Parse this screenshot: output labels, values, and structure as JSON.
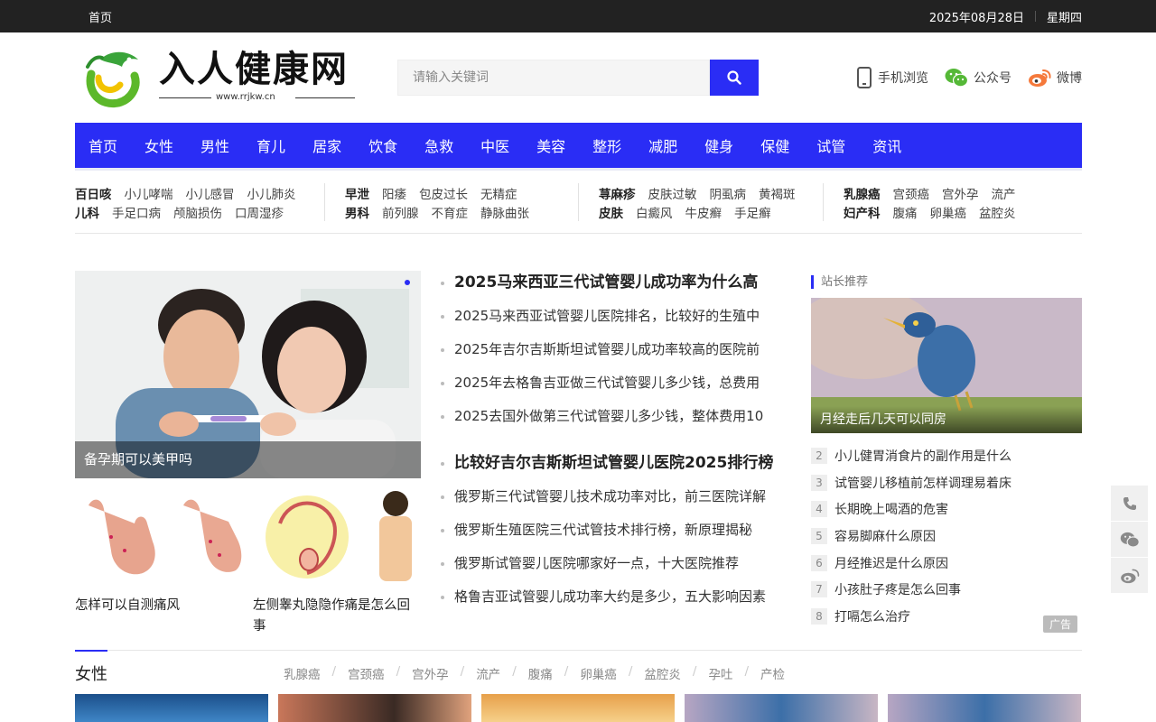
{
  "topbar": {
    "home": "首页",
    "date": "2025年08月28日",
    "weekday": "星期四"
  },
  "logo": {
    "name": "入人健康网",
    "url": "www.rrjkw.cn"
  },
  "search": {
    "placeholder": "请输入关键词"
  },
  "header_links": {
    "mobile": "手机浏览",
    "wechat": "公众号",
    "weibo": "微博"
  },
  "nav": [
    "首页",
    "女性",
    "男性",
    "育儿",
    "居家",
    "饮食",
    "急救",
    "中医",
    "美容",
    "整形",
    "减肥",
    "健身",
    "保健",
    "试管",
    "资讯"
  ],
  "tag_groups": [
    {
      "rows": [
        {
          "head": "百日咳",
          "items": [
            "小儿哮喘",
            "小儿感冒",
            "小儿肺炎"
          ]
        },
        {
          "head": "儿科",
          "items": [
            "手足口病",
            "颅脑损伤",
            "口周湿疹"
          ]
        }
      ]
    },
    {
      "rows": [
        {
          "head": "早泄",
          "items": [
            "阳痿",
            "包皮过长",
            "无精症"
          ]
        },
        {
          "head": "男科",
          "items": [
            "前列腺",
            "不育症",
            "静脉曲张"
          ]
        }
      ]
    },
    {
      "rows": [
        {
          "head": "荨麻疹",
          "items": [
            "皮肤过敏",
            "阴虱病",
            "黄褐斑"
          ]
        },
        {
          "head": "皮肤",
          "items": [
            "白癜风",
            "牛皮癣",
            "手足癣"
          ]
        }
      ]
    },
    {
      "rows": [
        {
          "head": "乳腺癌",
          "items": [
            "宫颈癌",
            "宫外孕",
            "流产"
          ]
        },
        {
          "head": "妇产科",
          "items": [
            "腹痛",
            "卵巢癌",
            "盆腔炎"
          ]
        }
      ]
    }
  ],
  "hero": {
    "caption": "备孕期可以美甲吗"
  },
  "thumbs": [
    {
      "caption": "怎样可以自测痛风"
    },
    {
      "caption": "左侧睾丸隐隐作痛是怎么回事"
    }
  ],
  "news_group1": [
    "2025马来西亚三代试管婴儿成功率为什么高",
    "2025马来西亚试管婴儿医院排名，比较好的生殖中",
    "2025年吉尔吉斯斯坦试管婴儿成功率较高的医院前",
    "2025年去格鲁吉亚做三代试管婴儿多少钱，总费用",
    "2025去国外做第三代试管婴儿多少钱，整体费用10"
  ],
  "news_group2": [
    "比较好吉尔吉斯斯坦试管婴儿医院2025排行榜",
    "俄罗斯三代试管婴儿技术成功率对比，前三医院详解",
    "俄罗斯生殖医院三代试管技术排行榜，新原理揭秘",
    "俄罗斯试管婴儿医院哪家好一点，十大医院推荐",
    "格鲁吉亚试管婴儿成功率大约是多少，五大影响因素"
  ],
  "sidebar": {
    "title": "站长推荐",
    "feature_caption": "月经走后几天可以同房",
    "ranks": [
      {
        "n": "2",
        "text": "小儿健胃消食片的副作用是什么"
      },
      {
        "n": "3",
        "text": "试管婴儿移植前怎样调理易着床"
      },
      {
        "n": "4",
        "text": "长期晚上喝酒的危害"
      },
      {
        "n": "5",
        "text": "容易脚麻什么原因"
      },
      {
        "n": "6",
        "text": "月经推迟是什么原因"
      },
      {
        "n": "7",
        "text": "小孩肚子疼是怎么回事"
      },
      {
        "n": "8",
        "text": "打嗝怎么治疗"
      }
    ],
    "ad": "广告"
  },
  "section": {
    "title": "女性",
    "tags": [
      "乳腺癌",
      "宫颈癌",
      "宫外孕",
      "流产",
      "腹痛",
      "卵巢癌",
      "盆腔炎",
      "孕吐",
      "产检"
    ]
  },
  "colors": {
    "accent": "#2a2df5",
    "topbar": "#222222"
  },
  "icons": {
    "search": "search-icon",
    "phone": "phone-icon",
    "wechat": "wechat-icon",
    "weibo": "weibo-icon"
  }
}
